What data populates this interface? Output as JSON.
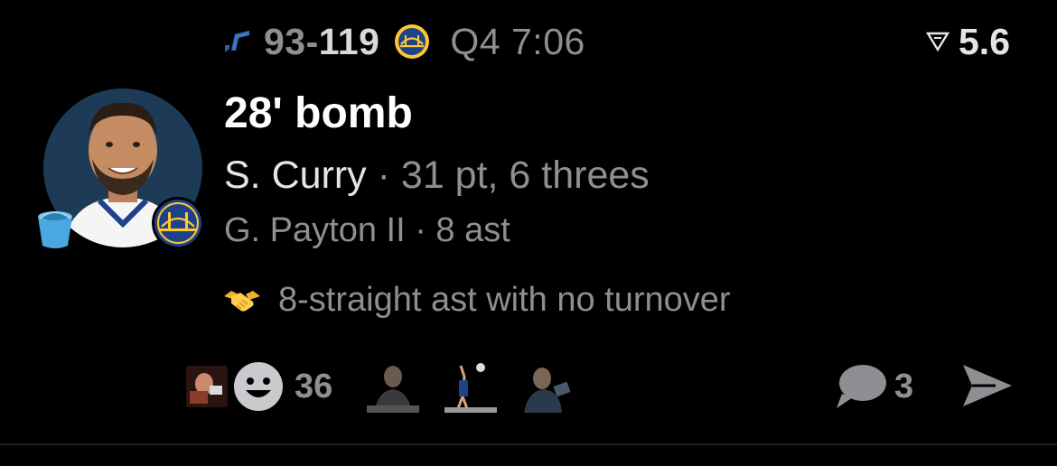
{
  "score": {
    "home_team_icon": "utah-jazz-note-icon",
    "home_score": "93",
    "dash": "-",
    "away_score": "119",
    "away_team_icon": "warriors-logo-icon",
    "clock": "Q4 7:06"
  },
  "metric": {
    "icon": "triangle-filter-icon",
    "value": "5.6"
  },
  "play": {
    "headline": "28' bomb",
    "player": "S. Curry",
    "player_stats": " · 31 pt, 6 threes",
    "assist_line": "G. Payton II · 8 ast",
    "note": "8-straight ast with no turnover",
    "note_icon": "handshake-icon"
  },
  "reactions": {
    "count": "36",
    "comment_count": "3"
  },
  "colors": {
    "background": "#000000",
    "primary_text": "#ffffff",
    "secondary_text": "#8e8e93",
    "warriors_blue": "#1d428a",
    "warriors_gold": "#ffc72c"
  }
}
